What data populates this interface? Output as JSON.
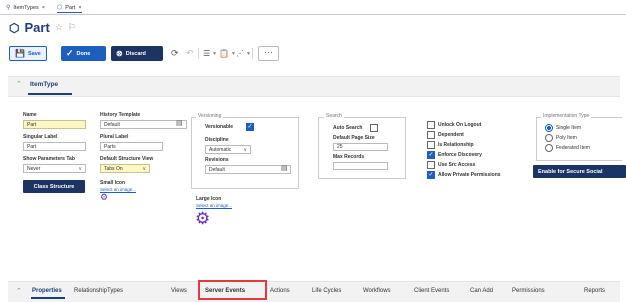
{
  "tabs": [
    {
      "label": "ItemTypes",
      "close": "×"
    },
    {
      "label": "Part",
      "close": "×"
    }
  ],
  "title": {
    "text": "Part"
  },
  "toolbar": {
    "save": "Save",
    "done": "Done",
    "discard": "Discard",
    "more": "···"
  },
  "section": {
    "title": "ItemType"
  },
  "form": {
    "name_label": "Name",
    "name_value": "Part",
    "singular_label": "Singular Label",
    "singular_value": "Part",
    "show_params_label": "Show Parameters Tab",
    "show_params_value": "Never",
    "class_structure_button": "Class Structure",
    "history_label": "History Template",
    "history_value": "Default",
    "plural_label": "Plural Label",
    "plural_value": "Parts",
    "default_view_label": "Default Structure View",
    "default_view_value": "Tabs On",
    "small_icon_label": "Small Icon",
    "small_icon_link": "Select an image...",
    "large_icon_label": "Large Icon",
    "large_icon_link": "Select an image..."
  },
  "versioning": {
    "title": "Versioning",
    "versionable_label": "Versionable",
    "versionable_checked": true,
    "discipline_label": "Discipline",
    "discipline_value": "Automatic",
    "revisions_label": "Revisions",
    "revisions_value": "Default"
  },
  "search": {
    "title": "Search",
    "auto_search_label": "Auto Search",
    "auto_search_checked": false,
    "page_size_label": "Default Page Size",
    "page_size_value": "25",
    "max_records_label": "Max Records",
    "max_records_value": ""
  },
  "options": [
    {
      "label": "Unlock On Logout",
      "checked": false
    },
    {
      "label": "Dependent",
      "checked": false
    },
    {
      "label": "Is Relationship",
      "checked": false
    },
    {
      "label": "Enforce Discovery",
      "checked": true
    },
    {
      "label": "Use Src Access",
      "checked": false
    },
    {
      "label": "Allow Private Permissions",
      "checked": true
    }
  ],
  "implementation": {
    "title": "Implementation Type",
    "options": [
      {
        "label": "Single Item",
        "selected": true
      },
      {
        "label": "Poly Item",
        "selected": false
      },
      {
        "label": "Federated Item",
        "selected": false
      }
    ]
  },
  "secure_social_button": "Enable for Secure Social",
  "bottom_tabs": [
    {
      "label": "Properties",
      "active": true
    },
    {
      "label": "RelationshipTypes",
      "active": false
    },
    {
      "label": "Views",
      "active": false
    },
    {
      "label": "Server Events",
      "active": false,
      "highlighted": true
    },
    {
      "label": "Actions",
      "active": false
    },
    {
      "label": "Life Cycles",
      "active": false
    },
    {
      "label": "Workflows",
      "active": false
    },
    {
      "label": "Client Events",
      "active": false
    },
    {
      "label": "Can Add",
      "active": false
    },
    {
      "label": "Permissions",
      "active": false
    },
    {
      "label": "Reports",
      "active": false
    }
  ],
  "colors": {
    "accent": "#1d5fbf",
    "navy": "#1b3463",
    "highlight": "#e33b3b",
    "required": "#fdf7c4"
  }
}
